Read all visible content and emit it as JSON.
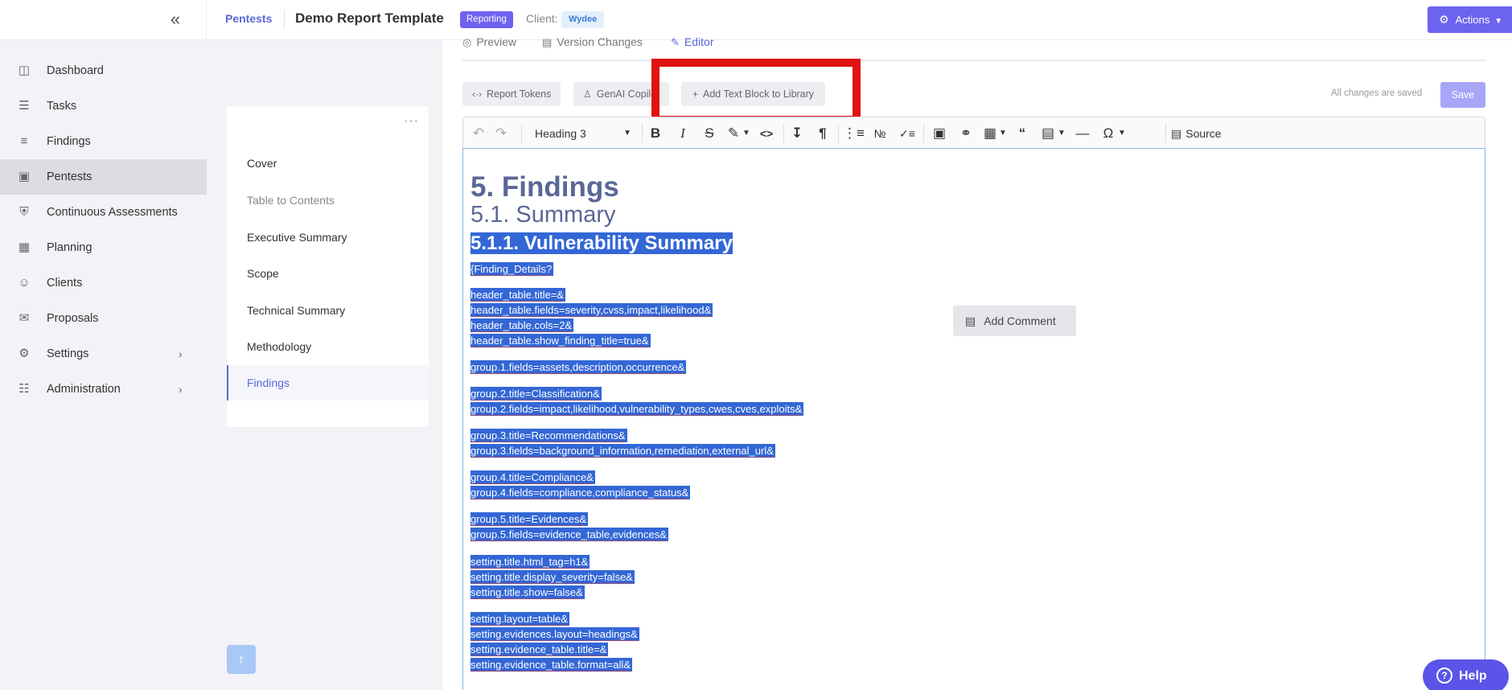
{
  "header": {
    "collapse_icon": "double-chevron-left-icon",
    "crumb": "Pentests",
    "title": "Demo Report Template",
    "badge": "Reporting",
    "client_label": "Client:",
    "client": "Wydee",
    "actions_label": "Actions",
    "colors": {
      "accent": "#6c63f0",
      "link": "#5a67d8"
    }
  },
  "sidebar": {
    "items": [
      {
        "label": "Dashboard",
        "icon": "dashboard-icon"
      },
      {
        "label": "Tasks",
        "icon": "tasks-icon"
      },
      {
        "label": "Findings",
        "icon": "findings-icon"
      },
      {
        "label": "Pentests",
        "icon": "pentests-icon",
        "active": true
      },
      {
        "label": "Continuous Assessments",
        "icon": "shield-icon"
      },
      {
        "label": "Planning",
        "icon": "calendar-icon"
      },
      {
        "label": "Clients",
        "icon": "clients-icon"
      },
      {
        "label": "Proposals",
        "icon": "proposals-icon"
      },
      {
        "label": "Settings",
        "icon": "gear-icon",
        "expandable": true
      },
      {
        "label": "Administration",
        "icon": "sliders-icon",
        "expandable": true
      }
    ]
  },
  "outline": {
    "menu": "···",
    "items": [
      {
        "label": "Cover"
      },
      {
        "label": "Table to Contents",
        "muted": true
      },
      {
        "label": "Executive Summary"
      },
      {
        "label": "Scope"
      },
      {
        "label": "Technical Summary"
      },
      {
        "label": "Methodology"
      },
      {
        "label": "Findings",
        "active": true
      }
    ]
  },
  "view_tabs": [
    {
      "label": "Preview",
      "icon": "eye-icon"
    },
    {
      "label": "Version Changes",
      "icon": "document-icon"
    },
    {
      "label": "Editor",
      "icon": "pencil-icon",
      "active": true
    }
  ],
  "actions": {
    "report_tokens": "Report Tokens",
    "genai": "GenAI Copilot",
    "add_block": "Add Text Block to Library",
    "saved_status": "All changes are saved",
    "save": "Save"
  },
  "toolbar": {
    "heading_value": "Heading 3",
    "source_label": "Source"
  },
  "document": {
    "h1": "5. Findings",
    "h2": "5.1. Summary",
    "h3": "5.1.1. Vulnerability Summary",
    "lines": [
      "{Finding_Details?",
      "header_table.title=&",
      "header_table.fields=severity,cvss,impact,likelihood&",
      "header_table.cols=2&",
      "header_table.show_finding_title=true&",
      "group.1.fields=assets,description,occurrence&",
      "group.2.title=Classification&",
      "group.2.fields=impact,likelihood,vulnerability_types,cwes,cves,exploits&",
      "group.3.title=Recommendations&",
      "group.3.fields=background_information,remediation,external_url&",
      "group.4.title=Compliance&",
      "group.4.fields=compliance,compliance_status&",
      "group.5.title=Evidences&",
      "group.5.fields=evidence_table,evidences&",
      "setting.title.html_tag=h1&",
      "setting.title.display_severity=false&",
      "setting.title.show=false&",
      "setting.layout=table&",
      "setting.evidences.layout=headings&",
      "setting.evidence_table.title=&",
      "setting.evidence_table.format=all&"
    ],
    "selection_color": "#3367d6"
  },
  "comment_button": "Add Comment",
  "help_button": "Help"
}
